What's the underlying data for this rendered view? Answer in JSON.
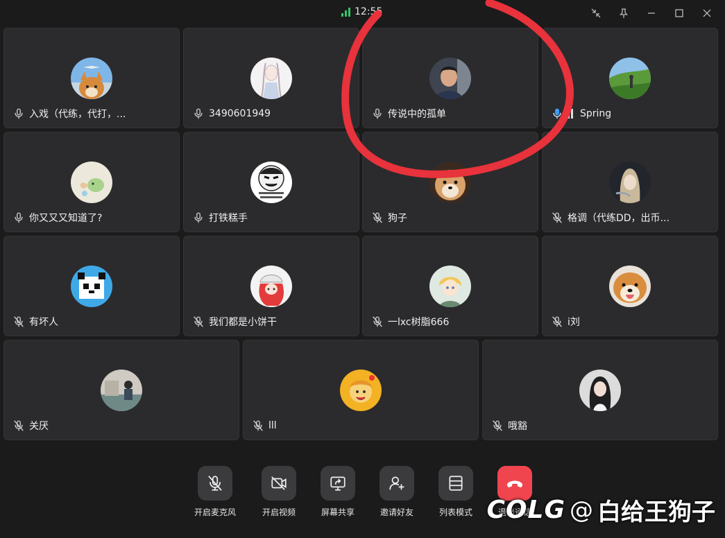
{
  "status": {
    "signal_text": "12:55"
  },
  "tiles": [
    {
      "name": "入戏（代练，代打，...",
      "muted": false,
      "avatar": "shiba-plane"
    },
    {
      "name": "3490601949",
      "muted": false,
      "avatar": "anime-girl-sketch"
    },
    {
      "name": "传说中的孤单",
      "muted": false,
      "avatar": "person-photo"
    },
    {
      "name": "Spring",
      "muted": false,
      "speaking": true,
      "avatar": "landscape-person"
    },
    {
      "name": "你又又又知道了?",
      "muted": false,
      "avatar": "cartoon-bird"
    },
    {
      "name": "打铁糕手",
      "muted": false,
      "avatar": "meme-face"
    },
    {
      "name": "狗子",
      "muted": true,
      "avatar": "dog-face"
    },
    {
      "name": "格调（代练DD，出币...",
      "muted": true,
      "avatar": "anime-dark-girl"
    },
    {
      "name": "有坏人",
      "muted": true,
      "avatar": "pixel-panda"
    },
    {
      "name": "我们都是小饼干",
      "muted": true,
      "avatar": "anime-red-hat"
    },
    {
      "name": "一lxc树脂666",
      "muted": true,
      "avatar": "anime-blond-boy"
    },
    {
      "name": "i刘",
      "muted": true,
      "avatar": "shiba-smile"
    },
    {
      "name": "关厌",
      "muted": true,
      "avatar": "room-photo"
    },
    {
      "name": "lll",
      "muted": true,
      "avatar": "cookie-character"
    },
    {
      "name": "哦豁",
      "muted": true,
      "avatar": "girl-portrait"
    }
  ],
  "toolbar": [
    {
      "label": "开启麦克风",
      "icon": "mic-off-icon"
    },
    {
      "label": "开启视频",
      "icon": "video-off-icon"
    },
    {
      "label": "屏幕共享",
      "icon": "screen-share-icon"
    },
    {
      "label": "邀请好友",
      "icon": "add-user-icon"
    },
    {
      "label": "列表模式",
      "icon": "list-mode-icon"
    },
    {
      "label": "退出通话",
      "icon": "hang-up-icon"
    }
  ],
  "watermark": {
    "logo": "COLG",
    "at": "@",
    "user": "白给王狗子"
  },
  "colors": {
    "accent_speaking": "#3aa0ff",
    "hangup": "#f0454f",
    "annotation": "#e8323c",
    "signal": "#35c46a"
  }
}
